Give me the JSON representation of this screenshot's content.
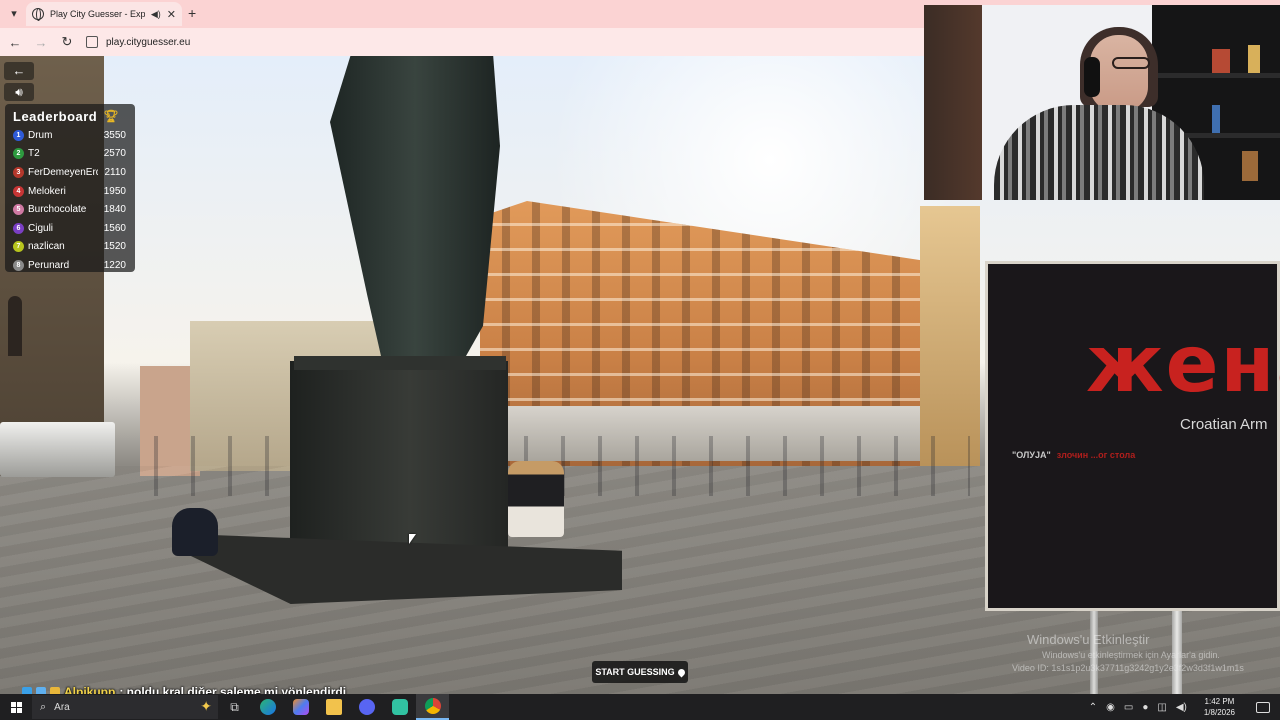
{
  "browser": {
    "tab_title": "Play City Guesser - Explore",
    "new_tab_icon": "plus-icon",
    "url": "play.cityguesser.eu"
  },
  "leaderboard": {
    "title": "Leaderboard",
    "entries": [
      {
        "rank": "1",
        "name": "Drum",
        "score": "3550",
        "color": "#2f5bd8"
      },
      {
        "rank": "2",
        "name": "T2",
        "score": "2570",
        "color": "#2e9a3f"
      },
      {
        "rank": "3",
        "name": "FerDemeyenErdi",
        "score": "2110",
        "color": "#b5382c"
      },
      {
        "rank": "4",
        "name": "Melokeri",
        "score": "1950",
        "color": "#c73535"
      },
      {
        "rank": "5",
        "name": "Burchocolate",
        "score": "1840",
        "color": "#d07aa3"
      },
      {
        "rank": "6",
        "name": "Ciguli",
        "score": "1560",
        "color": "#7b3fc4"
      },
      {
        "rank": "7",
        "name": "nazlican",
        "score": "1520",
        "color": "#b7c41d"
      },
      {
        "rank": "8",
        "name": "Perunard",
        "score": "1220",
        "color": "#8a8a8a"
      }
    ]
  },
  "game": {
    "start_label": "START GUESSING",
    "start_icon": "map-pin-icon"
  },
  "scene": {
    "poster_word": "жена",
    "poster_sub": "Croatian Arm",
    "poster_foot_1": "\"ОЛУЈА\"",
    "poster_foot_2": "злочин ...ог стола"
  },
  "chat": {
    "username": "Alpikupp",
    "message": ": noldu kral diğer saleme mi yönlendirdi"
  },
  "watermark": {
    "title": "Windows'u Etkinleştir",
    "subtitle": "Windows'u etkinleştirmek için Ayarlar'a gidin.",
    "video_id": "Video ID: 1s1s1p2u3k37711g3242g1y2e3f2w3d3f1w1m1s"
  },
  "taskbar": {
    "search_placeholder": "Ara",
    "time": "1:42 PM",
    "date": "1/8/2026"
  },
  "colors": {
    "tab_strip": "#fbd3d3",
    "poster_red": "#c8221f",
    "chat_username": "#f2d34a"
  }
}
